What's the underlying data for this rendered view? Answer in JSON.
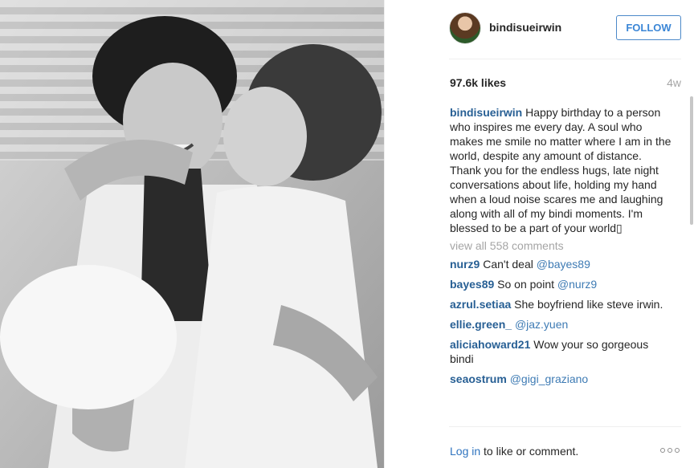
{
  "post": {
    "username": "bindisueirwin",
    "follow_label": "FOLLOW",
    "likes": "97.6k likes",
    "time_ago": "4w",
    "caption_user": "bindisueirwin",
    "caption_text": " Happy birthday to a person who inspires me every day. A soul who makes me smile no matter where I am in the world, despite any amount of distance. Thank you for the endless hugs, late night conversations about life, holding my hand when a loud noise scares me and laughing along with all of my bindi moments. I'm blessed to be a part of your world▯",
    "view_all": "view all 558 comments"
  },
  "comments": [
    {
      "user": "nurz9",
      "text": " Can't deal ",
      "mention": "@bayes89"
    },
    {
      "user": "bayes89",
      "text": " So on point ",
      "mention": "@nurz9"
    },
    {
      "user": "azrul.setiaa",
      "text": " She boyfriend like steve irwin.",
      "mention": ""
    },
    {
      "user": "ellie.green_",
      "text": " ",
      "mention": "@jaz.yuen"
    },
    {
      "user": "aliciahoward21",
      "text": " Wow your so gorgeous bindi",
      "mention": ""
    },
    {
      "user": "seaostrum",
      "text": " ",
      "mention": "@gigi_graziano"
    }
  ],
  "footer": {
    "login_link": "Log in",
    "login_suffix": " to like or comment."
  },
  "icons": {
    "more": "more-options-icon"
  },
  "colors": {
    "follow_blue": "#3b86d6",
    "username_blue": "#275f94",
    "muted": "#a5a5a5"
  }
}
